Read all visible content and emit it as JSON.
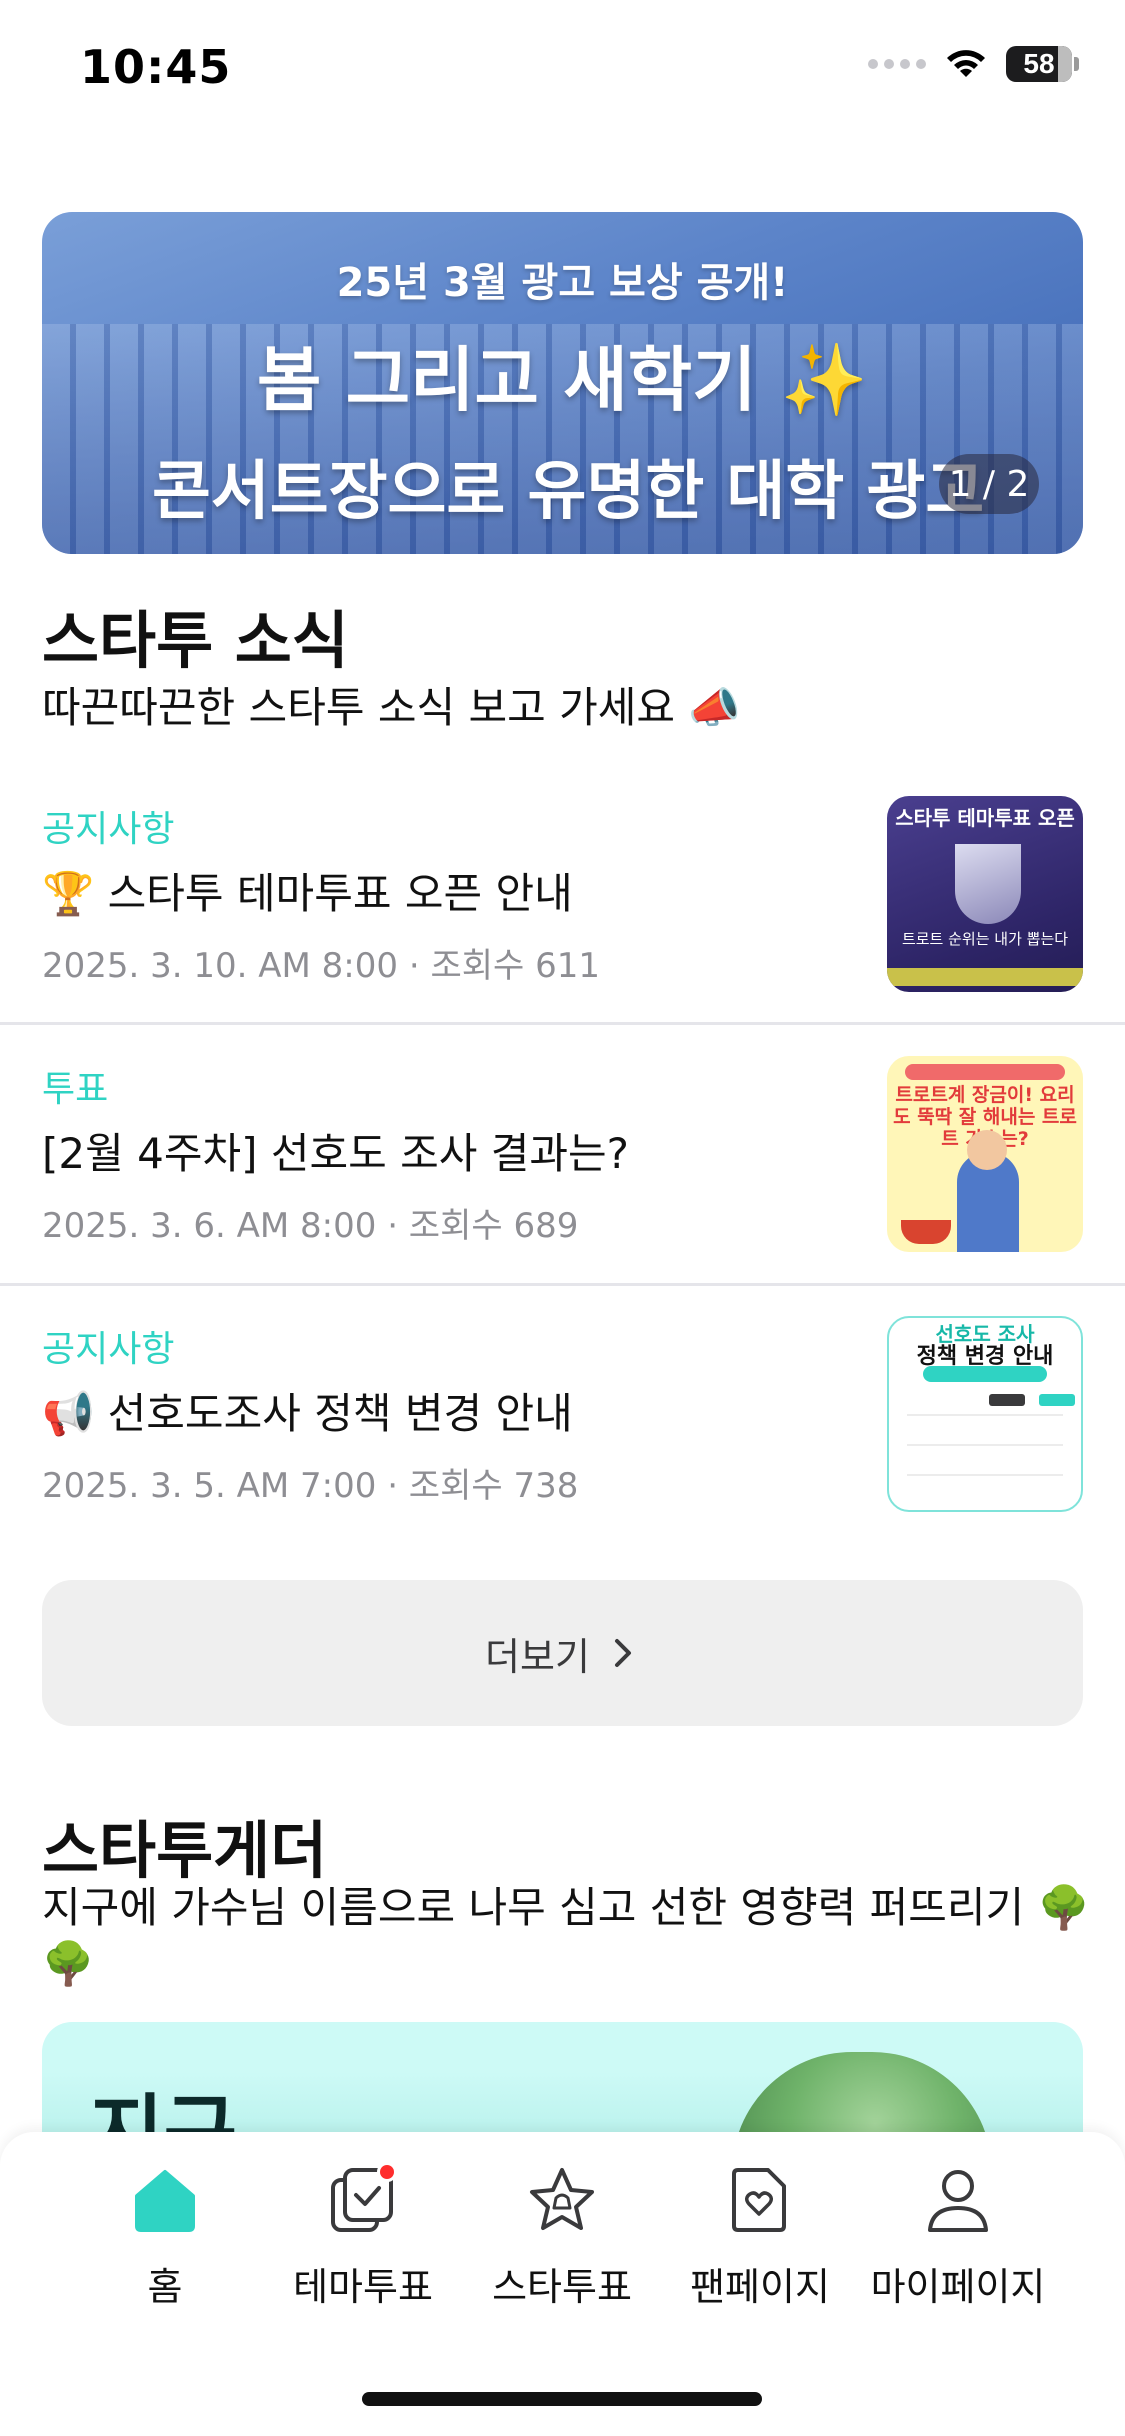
{
  "status_bar": {
    "time": "10:45",
    "battery": "58"
  },
  "banner": {
    "line1": "25년 3월 광고 보상 공개!",
    "line2": "봄 그리고 새학기 ✨",
    "line3": "콘서트장으로 유명한 대학 광고",
    "pager": "1 / 2"
  },
  "news_section": {
    "title": "스타투 소식",
    "description": "따끈따끈한 스타투 소식 보고 가세요 📣",
    "items": [
      {
        "category": "공지사항",
        "title": "🏆 스타투 테마투표 오픈 안내",
        "meta": "2025. 3. 10. AM 8:00 · 조회수 611",
        "thumb_title": "스타투 테마투표 오픈",
        "thumb_text": "트로트 순위는 내가 뽑는다"
      },
      {
        "category": "투표",
        "title": "[2월 4주차] 선호도 조사 결과는?",
        "meta": "2025. 3. 6. AM 8:00 · 조회수 689",
        "thumb_title": "트로트계 장금이! 요리도 뚝딱 잘 해내는 트로트 가수는?"
      },
      {
        "category": "공지사항",
        "title": "📢 선호도조사 정책 변경 안내",
        "meta": "2025. 3. 5. AM 7:00 · 조회수 738",
        "thumb_title": "선호도 조사",
        "thumb_subtitle": "정책 변경 안내"
      }
    ],
    "more_label": "더보기"
  },
  "gather_section": {
    "title": "스타투게더",
    "description": "지구에 가수님 이름으로 나무 심고 선한 영향력 퍼뜨리기 🌳 🌳",
    "banner_text": "지구"
  },
  "tab_bar": {
    "tabs": [
      {
        "label": "홈",
        "icon": "home-icon",
        "active": true
      },
      {
        "label": "테마투표",
        "icon": "theme-vote-icon",
        "badge": true
      },
      {
        "label": "스타투표",
        "icon": "star-vote-icon"
      },
      {
        "label": "팬페이지",
        "icon": "fan-page-icon"
      },
      {
        "label": "마이페이지",
        "icon": "my-page-icon"
      }
    ]
  },
  "colors": {
    "accent": "#2fd3c3",
    "meta": "#8e8e93",
    "badge": "#ff2d2d"
  }
}
